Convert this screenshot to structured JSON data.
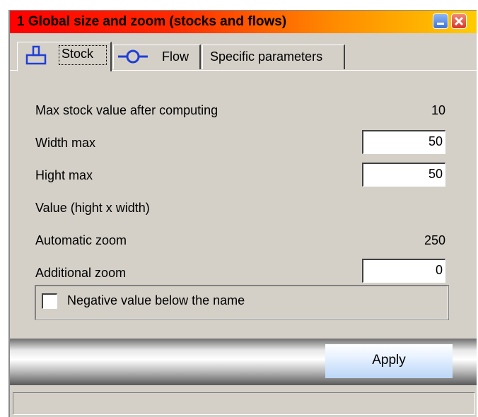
{
  "window": {
    "title": "1  Global size and zoom (stocks and flows)",
    "minimize_icon": "minimize-icon",
    "close_icon": "close-icon"
  },
  "tabs": [
    {
      "label": "Stock",
      "icon": "stock-icon",
      "active": true
    },
    {
      "label": "Flow",
      "icon": "flow-icon",
      "active": false
    },
    {
      "label": "Specific parameters",
      "active": false
    }
  ],
  "stock_tab": {
    "max_stock_label": "Max stock value after computing",
    "max_stock_value": "10",
    "width_max_label": "Width max",
    "width_max_value": "50",
    "hight_max_label": "Hight max",
    "hight_max_value": "50",
    "value_label": "Value (hight x width)",
    "auto_zoom_label": "Automatic zoom",
    "auto_zoom_value": "250",
    "additional_zoom_label": "Additional zoom",
    "additional_zoom_value": "0",
    "negative_checkbox_label": "Negative value below the name",
    "negative_checkbox_checked": false
  },
  "actions": {
    "apply_label": "Apply"
  },
  "status": {
    "text": ""
  },
  "colors": {
    "title_gradient_start": "#ff0000",
    "title_gradient_end": "#ffcc00",
    "icon_blue": "#1f3fd6",
    "face": "#d4d0c8"
  }
}
